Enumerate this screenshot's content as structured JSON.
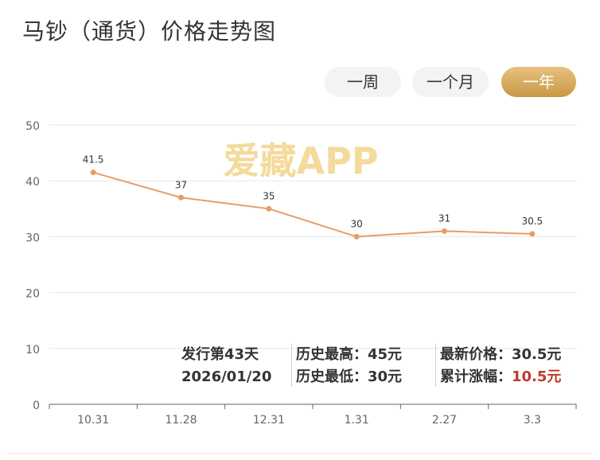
{
  "title": "马钞（通货）价格走势图",
  "range_tabs": {
    "week": "一周",
    "month": "一个月",
    "year": "一年",
    "active": "year"
  },
  "watermark": "爱藏APP",
  "stats": {
    "issue_days": "发行第43天",
    "issue_date": "2026/01/20",
    "hist_high_label": "历史最高：",
    "hist_high_value": "45元",
    "hist_low_label": "历史最低：",
    "hist_low_value": "30元",
    "latest_price_label": "最新价格：",
    "latest_price_value": "30.5元",
    "cum_change_label": "累计涨幅：",
    "cum_change_value": "10.5元"
  },
  "colors": {
    "line": "#e89c68",
    "active_tab": "#d4a55a",
    "highlight_value": "#c0392b",
    "watermark": "#f3d48a"
  },
  "chart_data": {
    "type": "line",
    "categories": [
      "10.31",
      "11.28",
      "12.31",
      "1.31",
      "2.27",
      "3.3"
    ],
    "series": [
      {
        "values": [
          41.5,
          37,
          35,
          30,
          31,
          30.5
        ],
        "labels": [
          "41.5",
          "37",
          "35",
          "30",
          "31",
          "30.5"
        ]
      }
    ],
    "ylim": [
      0,
      50
    ],
    "yticks": [
      "0",
      "10",
      "20",
      "30",
      "40",
      "50"
    ],
    "grid": true,
    "title": "",
    "xlabel": "",
    "ylabel": ""
  }
}
